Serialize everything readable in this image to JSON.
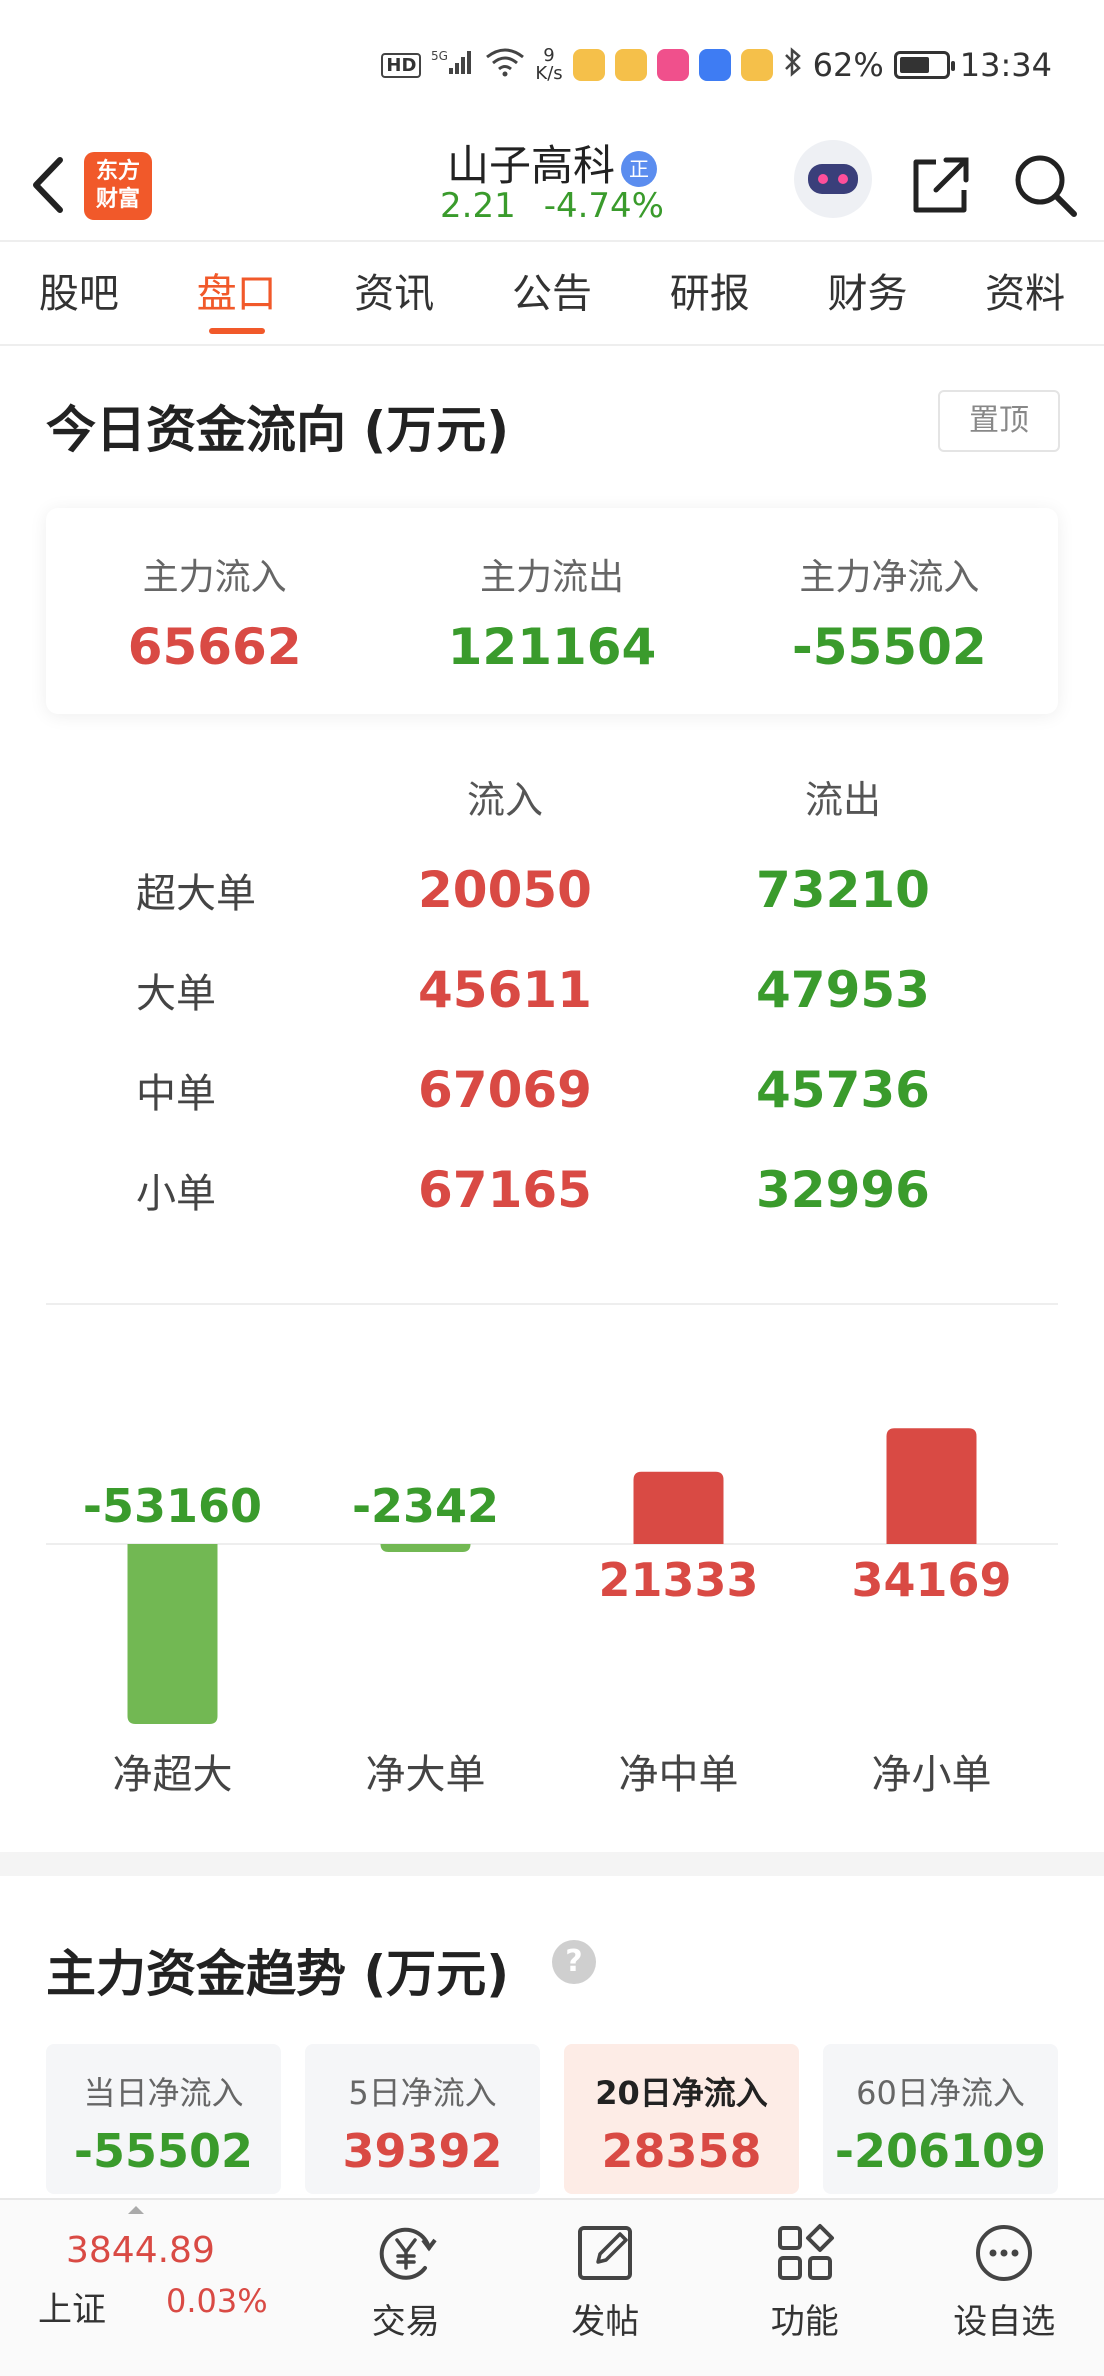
{
  "status_bar": {
    "hd": "HD",
    "signal": "5G",
    "net_speed_value": "9",
    "net_speed_unit": "K/s",
    "battery": "62%",
    "time": "13:34"
  },
  "header": {
    "logo_text_line1": "东方",
    "logo_text_line2": "财富",
    "stock_name": "山子高科",
    "badge": "正",
    "price": "2.21",
    "change_pct": "-4.74%"
  },
  "tabs": [
    {
      "label": "股吧",
      "active": false
    },
    {
      "label": "盘口",
      "active": true
    },
    {
      "label": "资讯",
      "active": false
    },
    {
      "label": "公告",
      "active": false
    },
    {
      "label": "研报",
      "active": false
    },
    {
      "label": "财务",
      "active": false
    },
    {
      "label": "资料",
      "active": false
    }
  ],
  "fund_flow": {
    "title": "今日资金流向 (万元)",
    "pin_label": "置顶",
    "summary": [
      {
        "label": "主力流入",
        "value": "65662",
        "tone": "red"
      },
      {
        "label": "主力流出",
        "value": "121164",
        "tone": "green"
      },
      {
        "label": "主力净流入",
        "value": "-55502",
        "tone": "green"
      }
    ],
    "table": {
      "headers": [
        "",
        "流入",
        "流出"
      ],
      "rows": [
        {
          "label": "超大单",
          "in": "20050",
          "out": "73210"
        },
        {
          "label": "大单",
          "in": "45611",
          "out": "47953"
        },
        {
          "label": "中单",
          "in": "67069",
          "out": "45736"
        },
        {
          "label": "小单",
          "in": "67165",
          "out": "32996"
        }
      ]
    }
  },
  "chart_data": {
    "type": "bar",
    "categories": [
      "净超大",
      "净大单",
      "净中单",
      "净小单"
    ],
    "values": [
      -53160,
      -2342,
      21333,
      34169
    ],
    "labels": [
      "-53160",
      "-2342",
      "21333",
      "34169"
    ],
    "positive_color": "#d94a44",
    "negative_color": "#72b853"
  },
  "trend": {
    "title": "主力资金趋势 (万元)",
    "help_icon": "question-icon",
    "cards": [
      {
        "label": "当日净流入",
        "value": "-55502",
        "tone": "green",
        "active": false
      },
      {
        "label": "5日净流入",
        "value": "39392",
        "tone": "red",
        "active": false
      },
      {
        "label": "20日净流入",
        "value": "28358",
        "tone": "red",
        "active": true
      },
      {
        "label": "60日净流入",
        "value": "-206109",
        "tone": "green",
        "active": false
      }
    ]
  },
  "bottom_nav": {
    "index_value": "3844.89",
    "index_name": "上证",
    "index_change": "0.03%",
    "items": [
      {
        "label": "交易",
        "icon": "yuan-exchange-icon"
      },
      {
        "label": "发帖",
        "icon": "edit-icon"
      },
      {
        "label": "功能",
        "icon": "grid-icon"
      },
      {
        "label": "设自选",
        "icon": "more-icon"
      }
    ]
  },
  "colors": {
    "accent": "#f1592a",
    "up": "#d94a44",
    "down": "#3a9b2c"
  }
}
